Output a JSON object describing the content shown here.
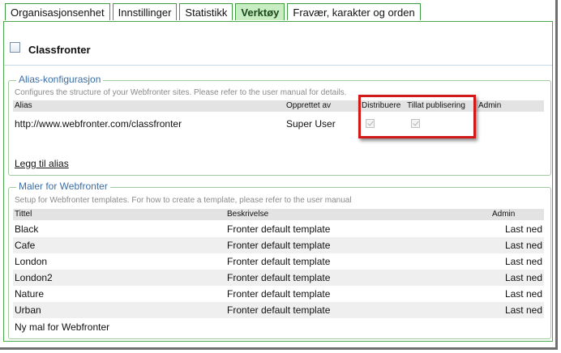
{
  "tabs": [
    {
      "label": "Organisasjonsenhet",
      "active": false
    },
    {
      "label": "Innstillinger",
      "active": false
    },
    {
      "label": "Statistikk",
      "active": false
    },
    {
      "label": "Verktøy",
      "active": true
    },
    {
      "label": "Fravær, karakter og orden",
      "active": false
    }
  ],
  "header": {
    "title": "Classfronter"
  },
  "alias": {
    "legend": "Alias-konfigurasjon",
    "description": "Configures the structure of your Webfronter sites. Please refer to the user manual for details.",
    "columns": {
      "alias": "Alias",
      "created_by": "Opprettet av",
      "distribute": "Distribuere",
      "allow_publishing": "Tillat publisering",
      "admin": "Admin"
    },
    "rows": [
      {
        "alias": "http://www.webfronter.com/classfronter",
        "created_by": "Super User",
        "distribute": true,
        "allow_publishing": true
      }
    ],
    "add_alias_link": "Legg til alias"
  },
  "templates": {
    "legend": "Maler for Webfronter",
    "description": "Setup for Webfronter templates. For how to create a template, please refer to the user manual",
    "columns": {
      "title": "Tittel",
      "description": "Beskrivelse",
      "admin": "Admin"
    },
    "rows": [
      {
        "title": "Black",
        "description": "Fronter default template",
        "action": "Last ned"
      },
      {
        "title": "Cafe",
        "description": "Fronter default template",
        "action": "Last ned"
      },
      {
        "title": "London",
        "description": "Fronter default template",
        "action": "Last ned"
      },
      {
        "title": "London2",
        "description": "Fronter default template",
        "action": "Last ned"
      },
      {
        "title": "Nature",
        "description": "Fronter default template",
        "action": "Last ned"
      },
      {
        "title": "Urban",
        "description": "Fronter default template",
        "action": "Last ned"
      }
    ],
    "new_template_link": "Ny mal for Webfronter"
  },
  "colors": {
    "accent_green": "#3d9a3d",
    "active_tab_bg": "#c8edc2",
    "legend_blue": "#3a6ea5",
    "highlight_red": "#d21919"
  }
}
